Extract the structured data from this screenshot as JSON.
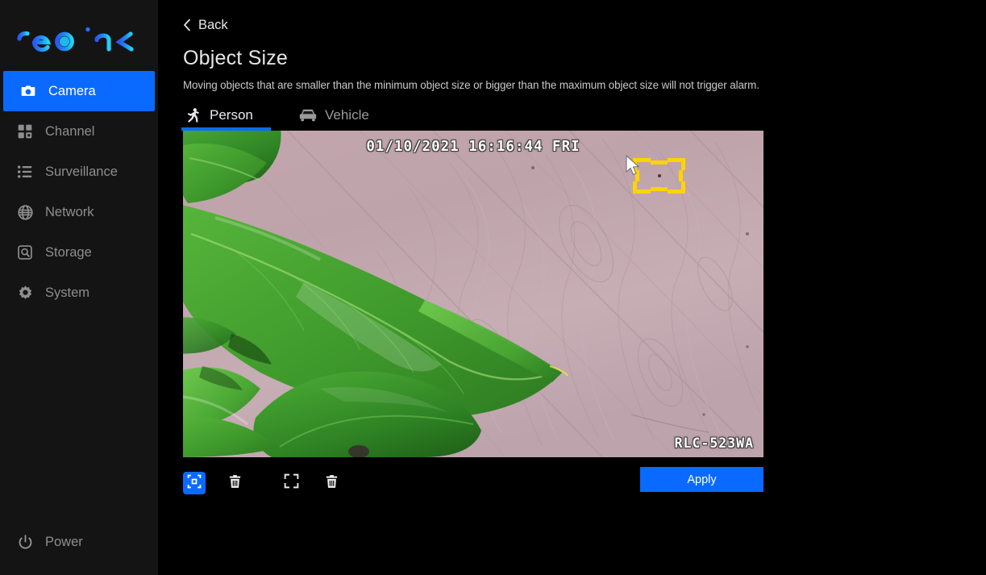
{
  "app": {
    "brand": "reolink",
    "brand_gradient_from": "#2a57f5",
    "brand_gradient_to": "#20c9f0",
    "accent_blue": "#0a6aff",
    "background": "#000000",
    "sidebar_background": "#141414"
  },
  "sidebar": {
    "items": [
      {
        "label": "Camera",
        "icon": "camera-icon",
        "active": true
      },
      {
        "label": "Channel",
        "icon": "grid-icon",
        "active": false
      },
      {
        "label": "Surveillance",
        "icon": "list-icon",
        "active": false
      },
      {
        "label": "Network",
        "icon": "globe-icon",
        "active": false
      },
      {
        "label": "Storage",
        "icon": "hard-drive-icon",
        "active": false
      },
      {
        "label": "System",
        "icon": "gear-icon",
        "active": false
      }
    ],
    "power": {
      "label": "Power",
      "icon": "power-icon"
    }
  },
  "main": {
    "back": {
      "label": "Back",
      "icon": "chevron-left-icon"
    },
    "title": "Object Size",
    "description": "Moving objects that are smaller than the minimum object size or bigger than the maximum object size will not trigger alarm.",
    "tabs": [
      {
        "label": "Person",
        "icon": "running-person-icon",
        "active": true
      },
      {
        "label": "Vehicle",
        "icon": "car-icon",
        "active": false
      }
    ],
    "video": {
      "timestamp": "01/10/2021  16:16:44  FRI",
      "camera_model": "RLC-523WA",
      "selection_box_color": "#ffd400",
      "scene": "indoor wood floor with green plant leaves"
    },
    "toolbar": {
      "buttons": [
        {
          "icon": "draw-min-box-icon",
          "selected": true
        },
        {
          "icon": "trash-icon",
          "selected": false
        },
        {
          "icon": "draw-max-box-icon",
          "selected": false
        },
        {
          "icon": "trash-icon",
          "selected": false
        }
      ],
      "apply_label": "Apply"
    }
  }
}
